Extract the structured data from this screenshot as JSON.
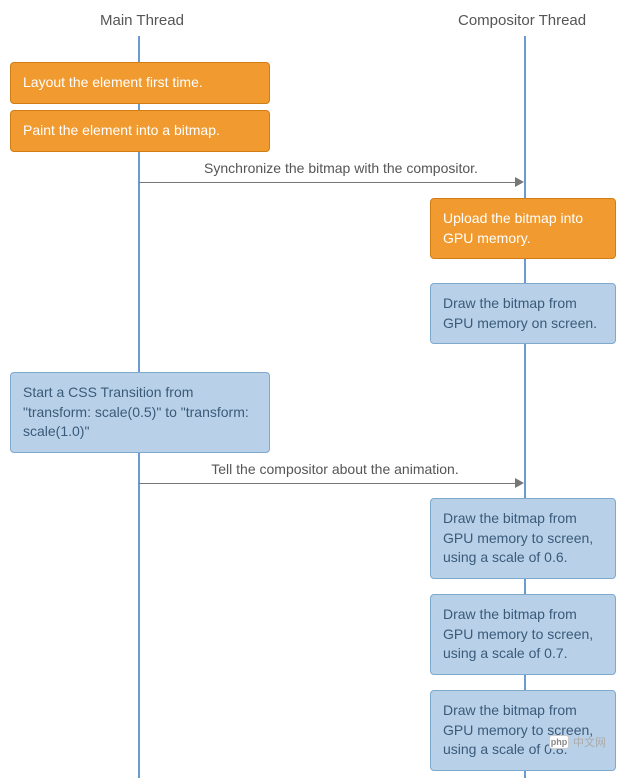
{
  "threads": {
    "main": {
      "label": "Main Thread"
    },
    "compositor": {
      "label": "Compositor Thread"
    }
  },
  "boxes": {
    "layout_first": "Layout the element first time.",
    "paint_bitmap": "Paint the element into a bitmap.",
    "upload_gpu": "Upload the bitmap into GPU memory.",
    "draw_gpu_screen": "Draw the bitmap from GPU memory on screen.",
    "start_transition": "Start a CSS Transition from \"transform: scale(0.5)\" to \"transform: scale(1.0)\"",
    "draw_scale_06": "Draw the bitmap from GPU memory to screen, using a scale of 0.6.",
    "draw_scale_07": "Draw the bitmap from GPU memory to screen, using a scale of 0.7.",
    "draw_scale_08": "Draw the bitmap from GPU memory to screen, using a scale of 0.8."
  },
  "arrows": {
    "sync_bitmap": "Synchronize the bitmap with the compositor.",
    "tell_animation": "Tell the compositor about the animation."
  },
  "watermark": {
    "icon_text": "php",
    "text": "中文网"
  }
}
